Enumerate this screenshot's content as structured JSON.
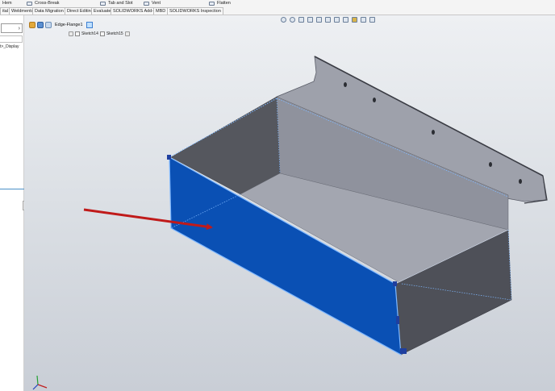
{
  "command_row": {
    "item_0": "Hem",
    "item_1": "Cross-Break",
    "item_2": "Tab and Slot",
    "item_3": "Vent",
    "item_4": "Flatten"
  },
  "tabs": [
    {
      "label": "ital"
    },
    {
      "label": "Weldments"
    },
    {
      "label": "Data Migration"
    },
    {
      "label": "Direct Editing"
    },
    {
      "label": "Evaluate"
    },
    {
      "label": "SOLIDWORKS Add-Ins"
    },
    {
      "label": "MBD"
    },
    {
      "label": "SOLIDWORKS Inspection"
    }
  ],
  "feature_panel": {
    "label": "t>_Display",
    "chevron": "›"
  },
  "breadcrumb": {
    "feature": "Edge-Flange1"
  },
  "sketches": {
    "first": "Sketch14",
    "second": "Sketch15"
  },
  "colors": {
    "selected_face": "#0a50b4",
    "body": "#8b8e99",
    "annotation_arrow": "#c01a1a",
    "edge_highlight": "#7fb8ff"
  },
  "icons": [
    "cross-break-icon",
    "tab-and-slot-icon",
    "vent-icon",
    "flatten-icon",
    "triad-icon"
  ]
}
